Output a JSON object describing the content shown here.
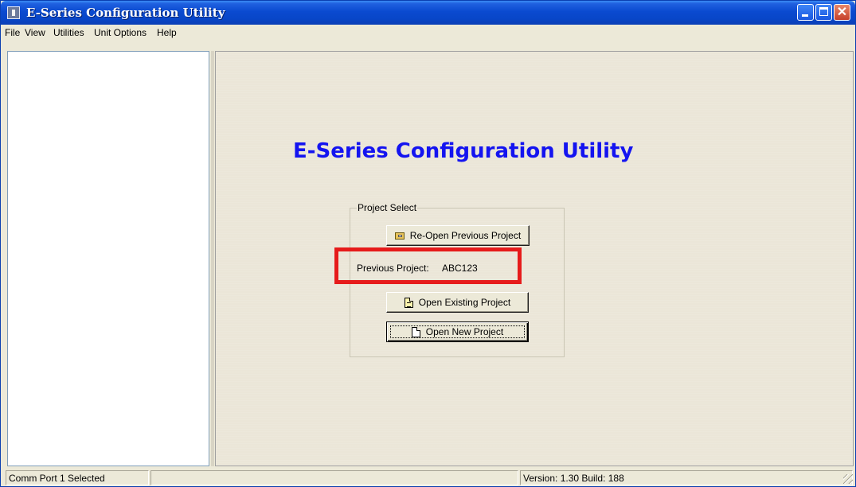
{
  "window": {
    "title": "E-Series Configuration Utility"
  },
  "menu": {
    "items": [
      {
        "id": "file",
        "label": "File"
      },
      {
        "id": "view",
        "label": "View"
      },
      {
        "id": "utilities",
        "label": "Utilities"
      },
      {
        "id": "unit-options",
        "label": "Unit Options"
      },
      {
        "id": "help",
        "label": "Help"
      }
    ]
  },
  "main": {
    "heading": "E-Series Configuration Utility",
    "project_select": {
      "group_label": "Project Select",
      "reopen_button": "Re-Open Previous Project",
      "previous_label": "Previous Project:",
      "previous_value": "ABC123",
      "open_existing_button": "Open Existing Project",
      "open_new_button": "Open New Project"
    },
    "highlight_color": "#e61b1b",
    "heading_color": "#1414f0"
  },
  "status": {
    "comm": "Comm Port 1 Selected",
    "middle": "",
    "version": "Version: 1.30 Build: 188"
  }
}
